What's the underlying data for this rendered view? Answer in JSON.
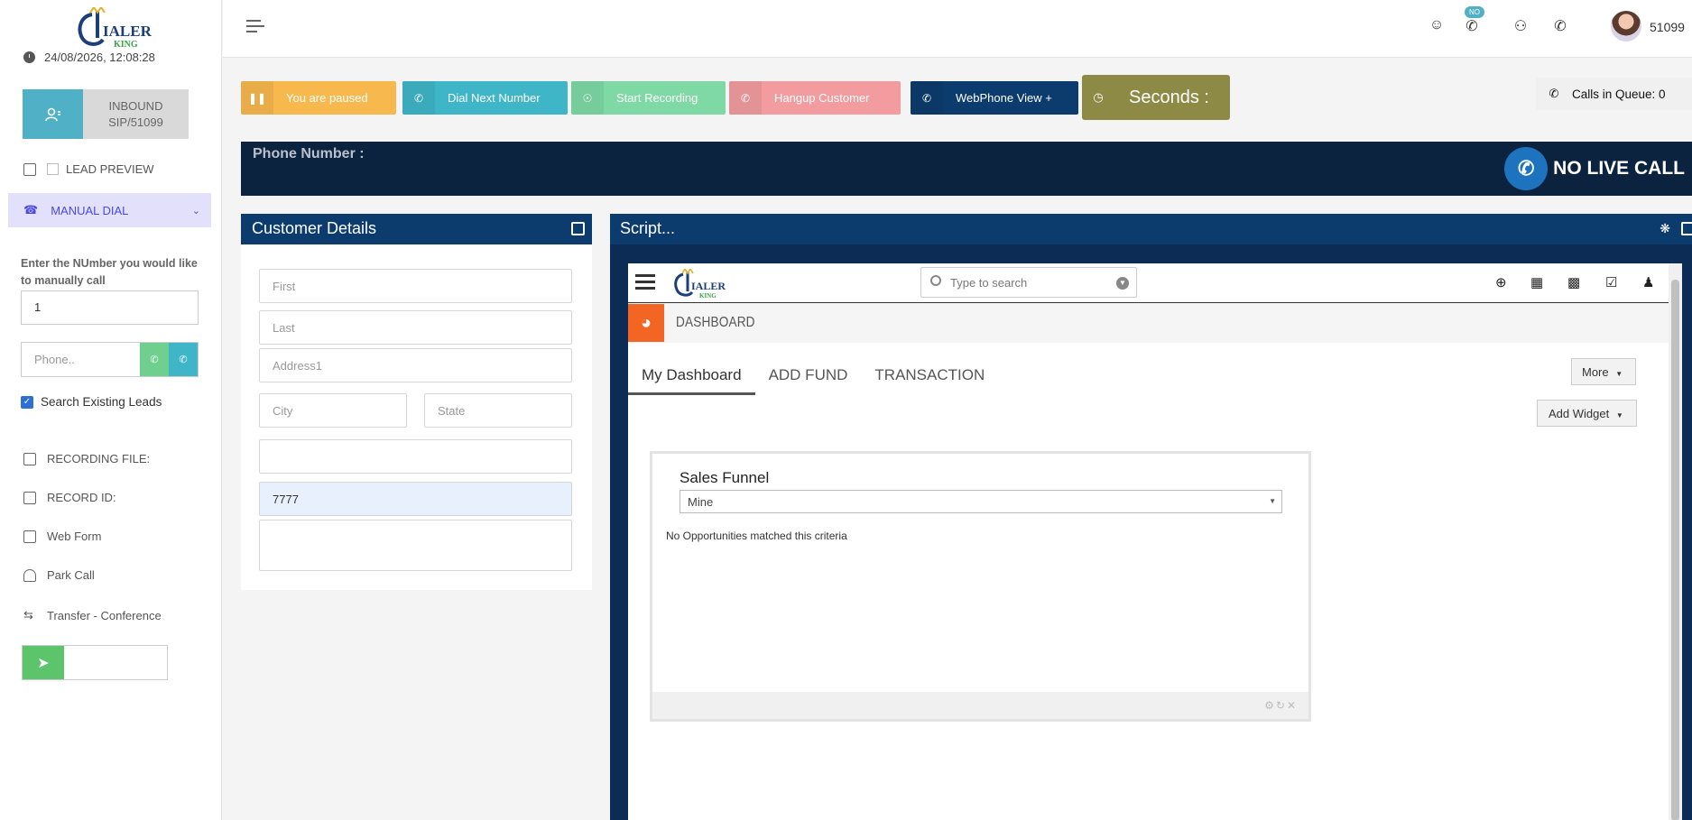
{
  "sidebar": {
    "datetime": "24/08/2026, 12:08:28",
    "inbound_line1": "INBOUND",
    "inbound_line2": "SIP/51099",
    "lead_preview": "LEAD PREVIEW",
    "manual_dial": "MANUAL DIAL",
    "enter_label": "Enter the NUmber you would like to manually call",
    "manual_number": "1",
    "phone_placeholder": "Phone..",
    "search_existing": "Search Existing Leads",
    "items": [
      {
        "label": "RECORDING FILE:",
        "icon": "recording-file-icon"
      },
      {
        "label": "RECORD ID:",
        "icon": "record-id-icon"
      },
      {
        "label": "Web Form",
        "icon": "web-form-icon"
      },
      {
        "label": "Park Call",
        "icon": "park-call-icon"
      },
      {
        "label": "Transfer - Conference",
        "icon": "transfer-icon"
      }
    ]
  },
  "header": {
    "badge": "NO",
    "user_id": "51099"
  },
  "actions": {
    "paused": "You are paused",
    "dial_next": "Dial Next Number",
    "start_recording": "Start Recording",
    "hangup": "Hangup Customer",
    "webphone": "WebPhone View +",
    "seconds": "Seconds :",
    "calls_in_queue": "Calls in Queue: 0"
  },
  "phone_bar": {
    "label": "Phone Number :",
    "status": "NO LIVE CALL"
  },
  "customer": {
    "title": "Customer Details",
    "first_placeholder": "First",
    "last_placeholder": "Last",
    "address_placeholder": "Address1",
    "city_placeholder": "City",
    "state_placeholder": "State",
    "phone_value": "7777"
  },
  "script": {
    "title": "Script...",
    "search_placeholder": "Type to search",
    "dashboard_label": "DASHBOARD",
    "tabs": [
      "My Dashboard",
      "ADD FUND",
      "TRANSACTION"
    ],
    "more": "More",
    "add_widget": "Add Widget",
    "widget_title": "Sales Funnel",
    "widget_select": "Mine",
    "widget_message": "No Opportunities matched this criteria"
  },
  "colors": {
    "paused": "#f7b84e",
    "dial_next": "#3fb6c8",
    "start_recording": "#7ed9a4",
    "hangup": "#f29ca0",
    "webphone": "#0c3c6e",
    "seconds": "#8d8a45",
    "navy": "#0c2340"
  }
}
